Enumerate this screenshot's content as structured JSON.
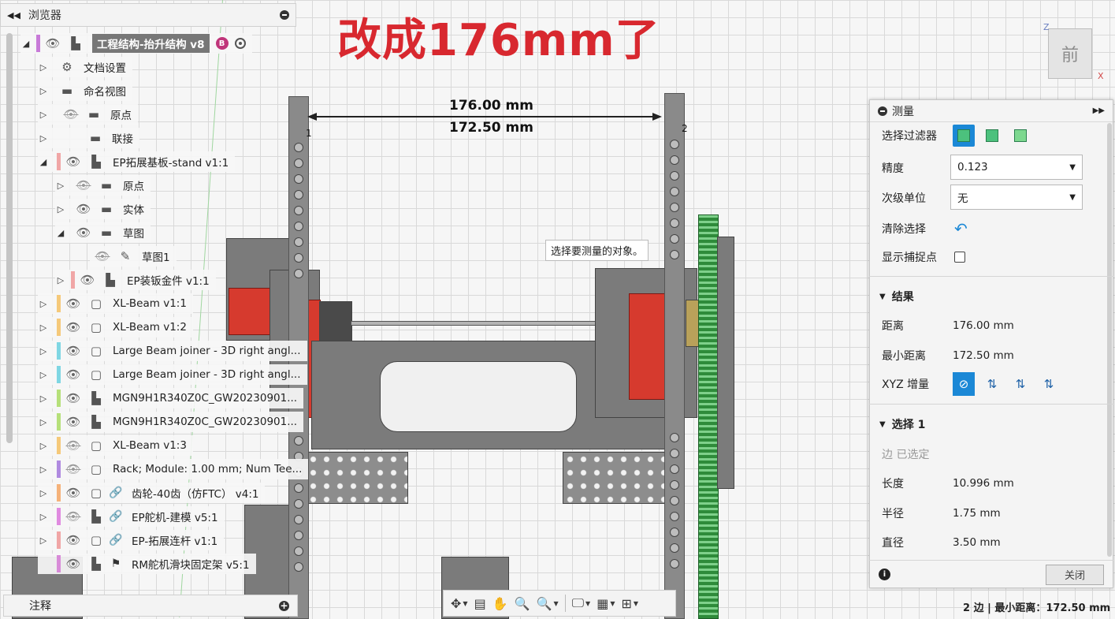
{
  "annotation_title": "改成176mm了",
  "dimension": {
    "distance": "176.00 mm",
    "min_distance": "172.50 mm",
    "point1": "1",
    "point2": "2"
  },
  "tooltip": "选择要测量的对象。",
  "browser": {
    "title": "浏览器",
    "root": "工程结构-抬升结构 v8",
    "root_badge": "B",
    "items": [
      {
        "label": "文档设置",
        "icon": "gear-icon"
      },
      {
        "label": "命名视图",
        "icon": "folder-icon"
      },
      {
        "label": "原点",
        "icon": "folder-icon"
      },
      {
        "label": "联接",
        "icon": "folder-icon"
      },
      {
        "label": "EP拓展基板-stand v1:1",
        "icon": "component-icon"
      },
      {
        "label": "原点",
        "icon": "folder-icon"
      },
      {
        "label": "实体",
        "icon": "folder-icon"
      },
      {
        "label": "草图",
        "icon": "folder-icon"
      },
      {
        "label": "草图1",
        "icon": "sketch-icon"
      },
      {
        "label": "EP装钣金件 v1:1",
        "icon": "component-icon"
      },
      {
        "label": "XL-Beam v1:1",
        "icon": "body-icon"
      },
      {
        "label": "XL-Beam v1:2",
        "icon": "body-icon"
      },
      {
        "label": "Large Beam joiner - 3D right angl...",
        "icon": "body-icon"
      },
      {
        "label": "Large Beam joiner - 3D right angl...",
        "icon": "body-icon"
      },
      {
        "label": "MGN9H1R340Z0C_GW20230901...",
        "icon": "component-icon"
      },
      {
        "label": "MGN9H1R340Z0C_GW20230901...",
        "icon": "component-icon"
      },
      {
        "label": "XL-Beam v1:3",
        "icon": "body-icon"
      },
      {
        "label": "Rack; Module: 1.00 mm; Num Tee...",
        "icon": "body-icon"
      },
      {
        "label": "齿轮-40齿（仿FTC） v4:1",
        "icon": "link-icon"
      },
      {
        "label": "EP舵机-建模 v5:1",
        "icon": "link-icon"
      },
      {
        "label": "EP-拓展连杆 v1:1",
        "icon": "link-icon"
      },
      {
        "label": "RM舵机滑块固定架 v5:1",
        "icon": "flag-icon"
      }
    ],
    "notes": "注释"
  },
  "viewcube": {
    "face": "前",
    "x": "X",
    "z": "Z"
  },
  "measure": {
    "title": "测量",
    "filter_label": "选择过滤器",
    "precision_label": "精度",
    "precision_value": "0.123",
    "secondary_unit_label": "次级单位",
    "secondary_unit_value": "无",
    "clear_selection_label": "清除选择",
    "show_snap_label": "显示捕捉点",
    "results_title": "结果",
    "distance_label": "距离",
    "distance_value": "176.00 mm",
    "min_distance_label": "最小距离",
    "min_distance_value": "172.50 mm",
    "xyz_label": "XYZ 增量",
    "selection_title": "选择 1",
    "edge_selected": "边 已选定",
    "length_label": "长度",
    "length_value": "10.996 mm",
    "radius_label": "半径",
    "radius_value": "1.75 mm",
    "diameter_label": "直径",
    "diameter_value": "3.50 mm",
    "close_label": "关闭"
  },
  "status_bar": "2 边 | 最小距离：172.50 mm",
  "colors": {
    "accent": "#1b88d6",
    "annotation_red": "#d8282f"
  }
}
